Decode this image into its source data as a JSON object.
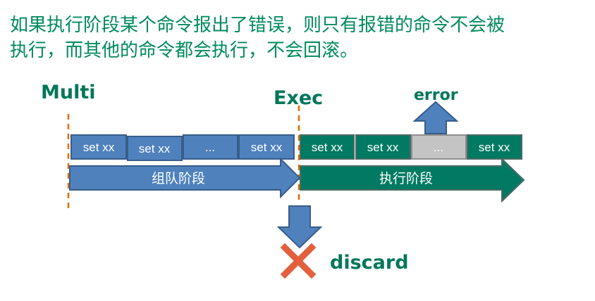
{
  "caption": {
    "line1": "如果执行阶段某个命令报出了错误，则只有报错的命令不会被",
    "line2": "执行，而其他的命令都会执行，不会回滚。"
  },
  "labels": {
    "multi": "Multi",
    "exec": "Exec",
    "error": "error",
    "discard": "discard"
  },
  "queue_phase": {
    "label": "组队阶段",
    "commands": [
      "set xx",
      "set xx",
      "...",
      "set xx"
    ]
  },
  "exec_phase": {
    "label": "执行阶段",
    "commands": [
      "set xx",
      "set xx",
      "...",
      "set xx"
    ]
  },
  "colors": {
    "blue": "#4f81bd",
    "blue_border": "#385d8a",
    "green": "#007a62",
    "green_border": "#4a6b63",
    "gray": "#c4c4c4",
    "dashed_line": "#e46c0a",
    "text_green": "#00775a",
    "cross": "#e2603d"
  }
}
